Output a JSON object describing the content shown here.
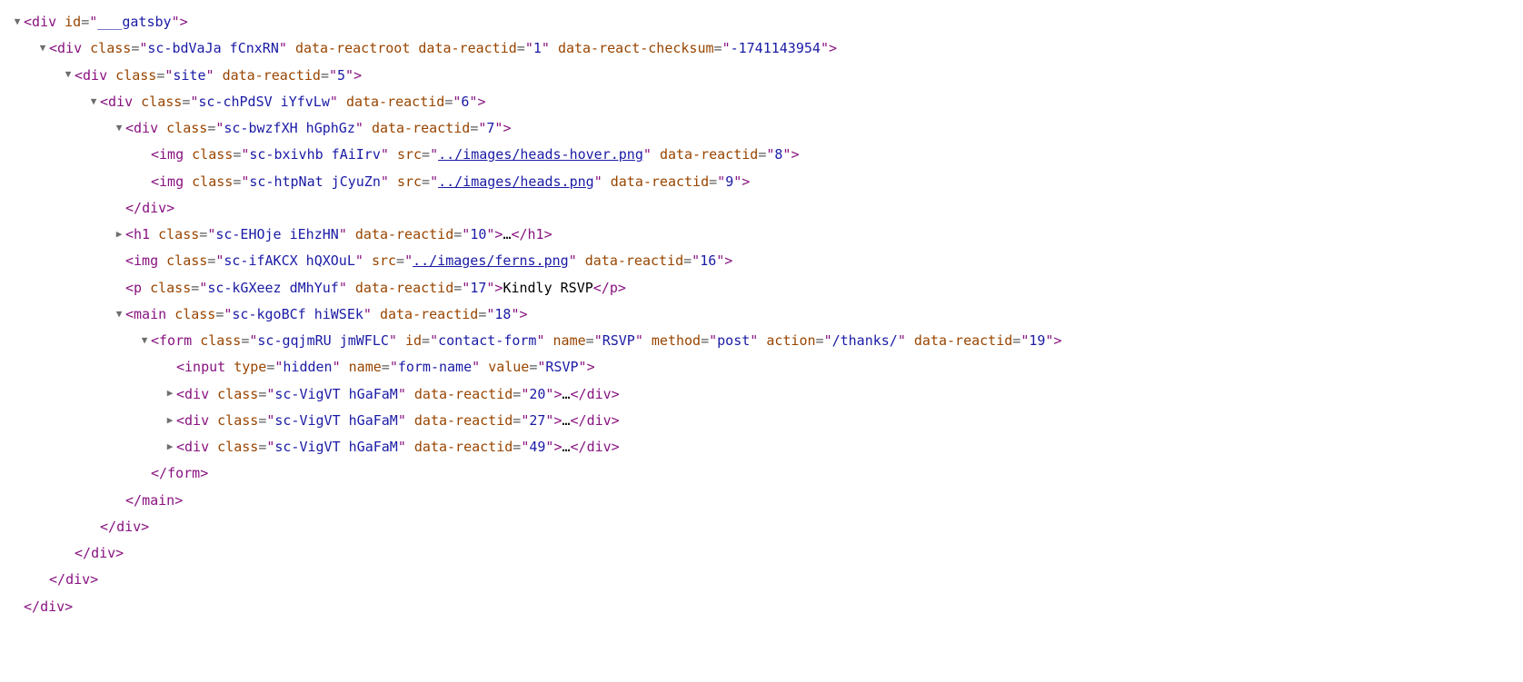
{
  "indentUnit": 28,
  "firstColOffset": 7,
  "arrowWidth": 14,
  "lines": [
    {
      "depth": 0,
      "arrow": "open",
      "kind": "open",
      "tag": "div",
      "attrs": [
        [
          "id",
          "___gatsby"
        ]
      ]
    },
    {
      "depth": 1,
      "arrow": "open",
      "kind": "open",
      "tag": "div",
      "attrs": [
        [
          "class",
          "sc-bdVaJa fCnxRN"
        ],
        [
          "data-reactroot",
          null
        ],
        [
          "data-reactid",
          "1"
        ],
        [
          "data-react-checksum",
          "-1741143954"
        ]
      ]
    },
    {
      "depth": 2,
      "arrow": "open",
      "kind": "open",
      "tag": "div",
      "attrs": [
        [
          "class",
          "site"
        ],
        [
          "data-reactid",
          "5"
        ]
      ]
    },
    {
      "depth": 3,
      "arrow": "open",
      "kind": "open",
      "tag": "div",
      "attrs": [
        [
          "class",
          "sc-chPdSV iYfvLw"
        ],
        [
          "data-reactid",
          "6"
        ]
      ]
    },
    {
      "depth": 4,
      "arrow": "open",
      "kind": "open",
      "tag": "div",
      "attrs": [
        [
          "class",
          "sc-bwzfXH hGphGz"
        ],
        [
          "data-reactid",
          "7"
        ]
      ]
    },
    {
      "depth": 5,
      "arrow": "none",
      "kind": "open",
      "tag": "img",
      "attrs": [
        [
          "class",
          "sc-bxivhb fAiIrv"
        ],
        [
          "src",
          "../images/heads-hover.png",
          "link"
        ],
        [
          "data-reactid",
          "8"
        ]
      ]
    },
    {
      "depth": 5,
      "arrow": "none",
      "kind": "open",
      "tag": "img",
      "attrs": [
        [
          "class",
          "sc-htpNat jCyuZn"
        ],
        [
          "src",
          "../images/heads.png",
          "link"
        ],
        [
          "data-reactid",
          "9"
        ]
      ]
    },
    {
      "depth": 4,
      "arrow": "none",
      "kind": "close",
      "tag": "div"
    },
    {
      "depth": 4,
      "arrow": "closed",
      "kind": "collapsed",
      "tag": "h1",
      "attrs": [
        [
          "class",
          "sc-EHOje iEhzHN"
        ],
        [
          "data-reactid",
          "10"
        ]
      ],
      "innerText": "…"
    },
    {
      "depth": 4,
      "arrow": "none",
      "kind": "open",
      "tag": "img",
      "attrs": [
        [
          "class",
          "sc-ifAKCX hQXOuL"
        ],
        [
          "src",
          "../images/ferns.png",
          "link"
        ],
        [
          "data-reactid",
          "16"
        ]
      ]
    },
    {
      "depth": 4,
      "arrow": "none",
      "kind": "collapsed",
      "tag": "p",
      "attrs": [
        [
          "class",
          "sc-kGXeez dMhYuf"
        ],
        [
          "data-reactid",
          "17"
        ]
      ],
      "innerText": "Kindly RSVP"
    },
    {
      "depth": 4,
      "arrow": "open",
      "kind": "open",
      "tag": "main",
      "attrs": [
        [
          "class",
          "sc-kgoBCf hiWSEk"
        ],
        [
          "data-reactid",
          "18"
        ]
      ]
    },
    {
      "depth": 5,
      "arrow": "open",
      "kind": "open",
      "tag": "form",
      "attrs": [
        [
          "class",
          "sc-gqjmRU jmWFLC"
        ],
        [
          "id",
          "contact-form"
        ],
        [
          "name",
          "RSVP"
        ],
        [
          "method",
          "post"
        ],
        [
          "action",
          "/thanks/"
        ],
        [
          "data-reactid",
          "19"
        ]
      ]
    },
    {
      "depth": 6,
      "arrow": "none",
      "kind": "open",
      "tag": "input",
      "attrs": [
        [
          "type",
          "hidden"
        ],
        [
          "name",
          "form-name"
        ],
        [
          "value",
          "RSVP"
        ]
      ]
    },
    {
      "depth": 6,
      "arrow": "closed",
      "kind": "collapsed",
      "tag": "div",
      "attrs": [
        [
          "class",
          "sc-VigVT hGaFaM"
        ],
        [
          "data-reactid",
          "20"
        ]
      ],
      "innerText": "…"
    },
    {
      "depth": 6,
      "arrow": "closed",
      "kind": "collapsed",
      "tag": "div",
      "attrs": [
        [
          "class",
          "sc-VigVT hGaFaM"
        ],
        [
          "data-reactid",
          "27"
        ]
      ],
      "innerText": "…"
    },
    {
      "depth": 6,
      "arrow": "closed",
      "kind": "collapsed",
      "tag": "div",
      "attrs": [
        [
          "class",
          "sc-VigVT hGaFaM"
        ],
        [
          "data-reactid",
          "49"
        ]
      ],
      "innerText": "…"
    },
    {
      "depth": 5,
      "arrow": "none",
      "kind": "close",
      "tag": "form"
    },
    {
      "depth": 4,
      "arrow": "none",
      "kind": "close",
      "tag": "main"
    },
    {
      "depth": 3,
      "arrow": "none",
      "kind": "close",
      "tag": "div"
    },
    {
      "depth": 2,
      "arrow": "none",
      "kind": "close",
      "tag": "div"
    },
    {
      "depth": 1,
      "arrow": "none",
      "kind": "close",
      "tag": "div"
    },
    {
      "depth": 0,
      "arrow": "none",
      "kind": "close",
      "tag": "div"
    }
  ]
}
